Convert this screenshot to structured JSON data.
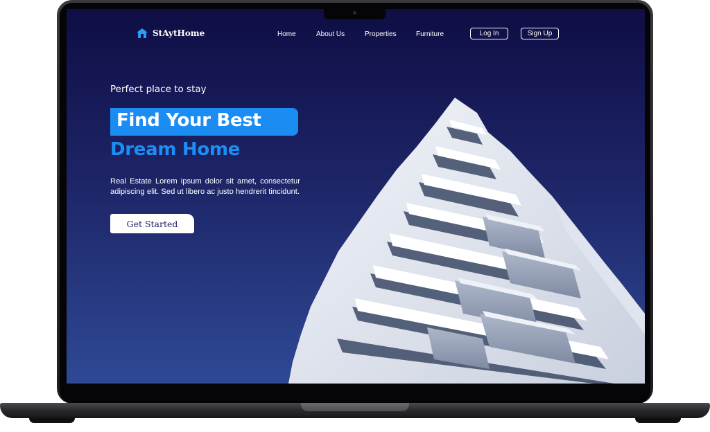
{
  "brand": {
    "name": "StAytHome",
    "icon": "house-icon"
  },
  "nav": {
    "links": [
      "Home",
      "About Us",
      "Properties",
      "Furniture"
    ],
    "login_label": "Log In",
    "signup_label": "Sign Up"
  },
  "hero": {
    "tagline": "Perfect place to stay",
    "headline_line1": "Find Your Best",
    "headline_line2": "Dream Home",
    "description": "Real Estate Lorem ipsum dolor sit amet, consectetur adipiscing elit. Sed ut libero ac justo hendrerit tincidunt.",
    "cta_label": "Get Started"
  },
  "colors": {
    "background_top": "#0f0e45",
    "background_bottom": "#2e4995",
    "accent_blue": "#1a8cf2",
    "button_text": "#1d2260"
  }
}
